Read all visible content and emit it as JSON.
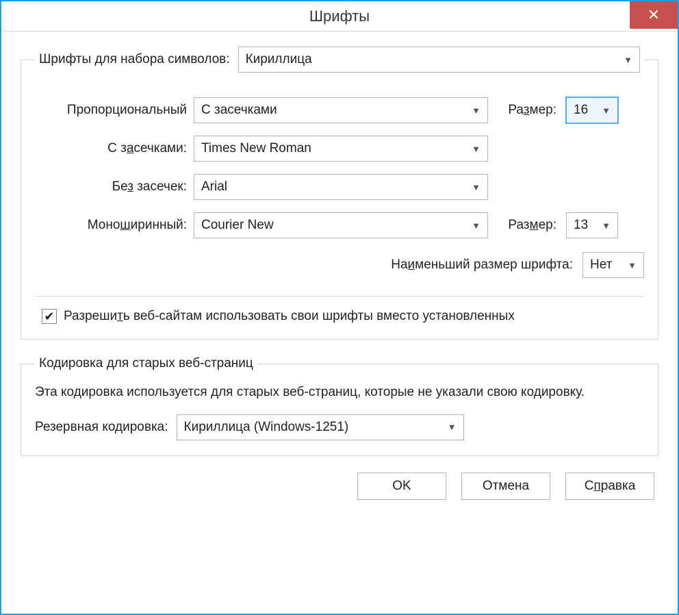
{
  "window": {
    "title": "Шрифты"
  },
  "charset": {
    "label": "Шрифты для набора символов:",
    "value": "Кириллица"
  },
  "fonts": {
    "proportional": {
      "label": "Пропорциональный",
      "value": "С засечками",
      "size_label": "Размер:",
      "size": "16"
    },
    "serif": {
      "label_pre": "С з",
      "label_u": "а",
      "label_post": "сечками:",
      "value": "Times New Roman"
    },
    "sans": {
      "label_pre": "Бе",
      "label_u": "з",
      "label_post": " засечек:",
      "value": "Arial"
    },
    "mono": {
      "label_pre": "Моно",
      "label_u": "ш",
      "label_post": "иринный:",
      "value": "Courier New",
      "size_label_pre": "Раз",
      "size_label_u": "м",
      "size_label_post": "ер:",
      "size": "13"
    },
    "minsize": {
      "label_pre": "На",
      "label_u": "и",
      "label_post": "меньший размер шрифта:",
      "value": "Нет"
    },
    "prop_size_label_pre": "Ра",
    "prop_size_label_u": "з",
    "prop_size_label_post": "мер:"
  },
  "allow_sites": {
    "checked": true,
    "label_pre": "Разреши",
    "label_u": "т",
    "label_post": "ь веб-сайтам использовать свои шрифты вместо установленных"
  },
  "encoding": {
    "group_title": "Кодировка для старых веб-страниц",
    "desc": "Эта кодировка используется для старых веб-страниц, которые не указали свою кодировку.",
    "label": "Резервная кодировка:",
    "value": "Кириллица (Windows-1251)"
  },
  "buttons": {
    "ok": "OK",
    "cancel": "Отмена",
    "help_pre": "С",
    "help_u": "п",
    "help_post": "равка"
  }
}
